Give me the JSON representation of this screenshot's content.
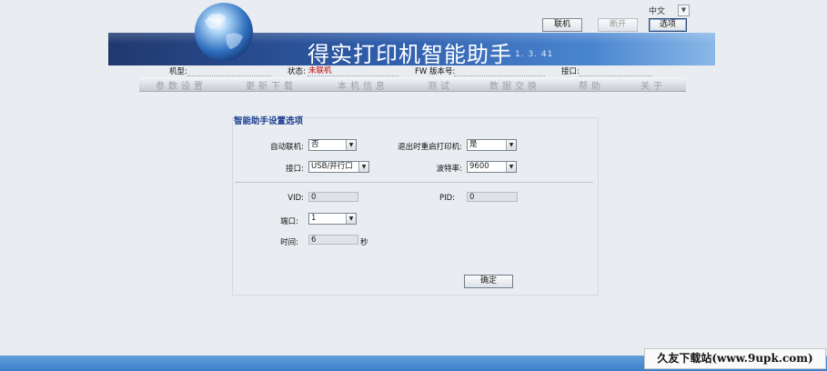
{
  "header": {
    "language": "中文",
    "buttons": {
      "connect": "联机",
      "disconnect": "断开",
      "options": "选项"
    }
  },
  "banner": {
    "title": "得实打印机智能助手",
    "version": "1. 3. 41"
  },
  "info": {
    "model_label": "机型:",
    "model_value": "",
    "status_label": "状态:",
    "status_value": "未联机",
    "fw_label": "FW 版本号:",
    "fw_value": "",
    "port_label": "接口:",
    "port_value": ""
  },
  "nav": {
    "tabs": [
      "参数设置",
      "更新下载",
      "本机信息",
      "测试",
      "数据交换",
      "帮助",
      "关于"
    ]
  },
  "panel": {
    "title": "智能助手设置选项",
    "auto_connect": {
      "label": "自动联机:",
      "value": "否"
    },
    "restart_on_exit": {
      "label": "退出时重启打印机:",
      "value": "是"
    },
    "interface": {
      "label": "接口:",
      "value": "USB/并行口"
    },
    "baud_rate": {
      "label": "波特率:",
      "value": "9600"
    },
    "vid": {
      "label": "VID:",
      "value": "0"
    },
    "pid": {
      "label": "PID:",
      "value": "0"
    },
    "com_port": {
      "label": "端口:",
      "value": "1"
    },
    "time": {
      "label": "时间:",
      "value": "6",
      "unit": "秒"
    },
    "ok_label": "确定"
  },
  "watermark": "久友下载站(www.9upk.com)",
  "colors": {
    "banner_dark": "#20386e",
    "banner_light": "#8ab8e8",
    "status_red": "#c00000",
    "panel_title": "#1d3f8f",
    "bottom_bar": "#3a7fc8"
  }
}
